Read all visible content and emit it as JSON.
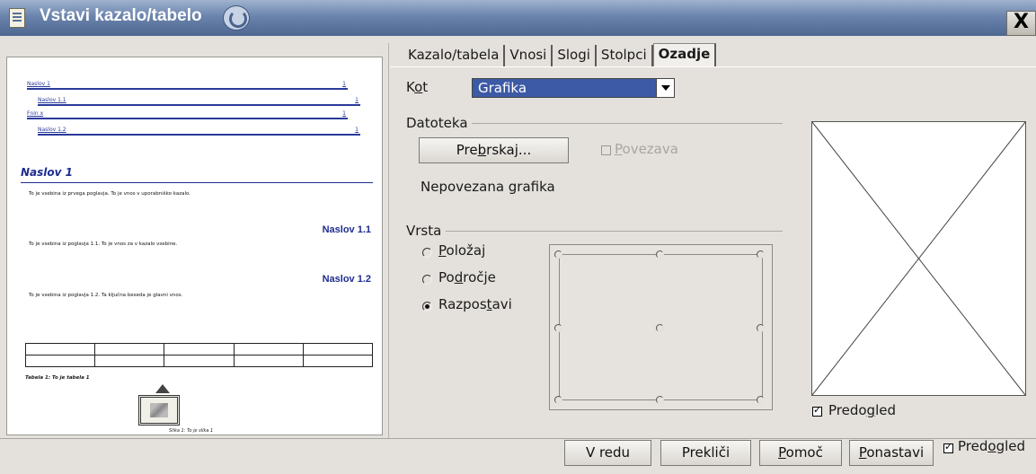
{
  "window": {
    "title": "Vstavi kazalo/tabelo",
    "close_glyph": "X",
    "icons": [
      "document-icon",
      "rollup-icon",
      "close-icon"
    ]
  },
  "preview": {
    "toc": [
      {
        "label": "Naslov 1",
        "page": "1"
      },
      {
        "label": "Naslov 1.1",
        "page": "1"
      },
      {
        "label": "Fnin x",
        "page": "1"
      },
      {
        "label": "Naslov 1.2",
        "page": "1"
      }
    ],
    "heading1": "Naslov 1",
    "body1": "To je vsebina iz prvega poglavja. To je vnos v uporabniško kazalo.",
    "heading11": "Naslov 1.1",
    "body11": "To je vsebina iz poglavja 1.1. To je vnos za v kazalo vsebine.",
    "heading12": "Naslov 1.2",
    "body12": "To je vsebina iz poglavja 1.2. Ta ključna beseda je glavni vnos.",
    "table_caption": "Tabela 1: To je tabela 1",
    "image_caption": "Slika 1: To je slika 1"
  },
  "tabs": [
    {
      "label": "Kazalo/tabela",
      "active": false
    },
    {
      "label": "Vnosi",
      "active": false
    },
    {
      "label": "Slogi",
      "active": false
    },
    {
      "label": "Stolpci",
      "active": false
    },
    {
      "label": "Ozadje",
      "active": true
    }
  ],
  "kot": {
    "label_pre": "K",
    "label_u": "o",
    "label_post": "t",
    "value": "Grafika"
  },
  "datoteka": {
    "title": "Datoteka",
    "browse_pre": "Pre",
    "browse_u": "b",
    "browse_post": "rskaj...",
    "link_u": "P",
    "link_post": "ovezava",
    "link_checked": false,
    "link_disabled": true,
    "status": "Nepovezana grafika"
  },
  "vrsta": {
    "title": "Vrsta",
    "options": [
      {
        "pre": "",
        "u": "P",
        "post": "oložaj",
        "selected": false
      },
      {
        "pre": "Po",
        "u": "d",
        "post": "ročje",
        "selected": false
      },
      {
        "pre": "Razpos",
        "u": "t",
        "post": "avi",
        "selected": true
      }
    ]
  },
  "graphic_preview": {
    "pre": "Predo",
    "u": "g",
    "post": "led",
    "checked": true
  },
  "footer": {
    "ok": "V redu",
    "cancel": "Prekliči",
    "help_u": "P",
    "help_post": "omoč",
    "reset_u": "P",
    "reset_post": "onastavi",
    "preview_pre": "Pred",
    "preview_u": "o",
    "preview_post": "gled",
    "preview_checked": true
  },
  "colors": {
    "accent": "#3c5aa5",
    "heading_blue": "#1e2c8f",
    "dialog_bg": "#e4e1dc"
  }
}
